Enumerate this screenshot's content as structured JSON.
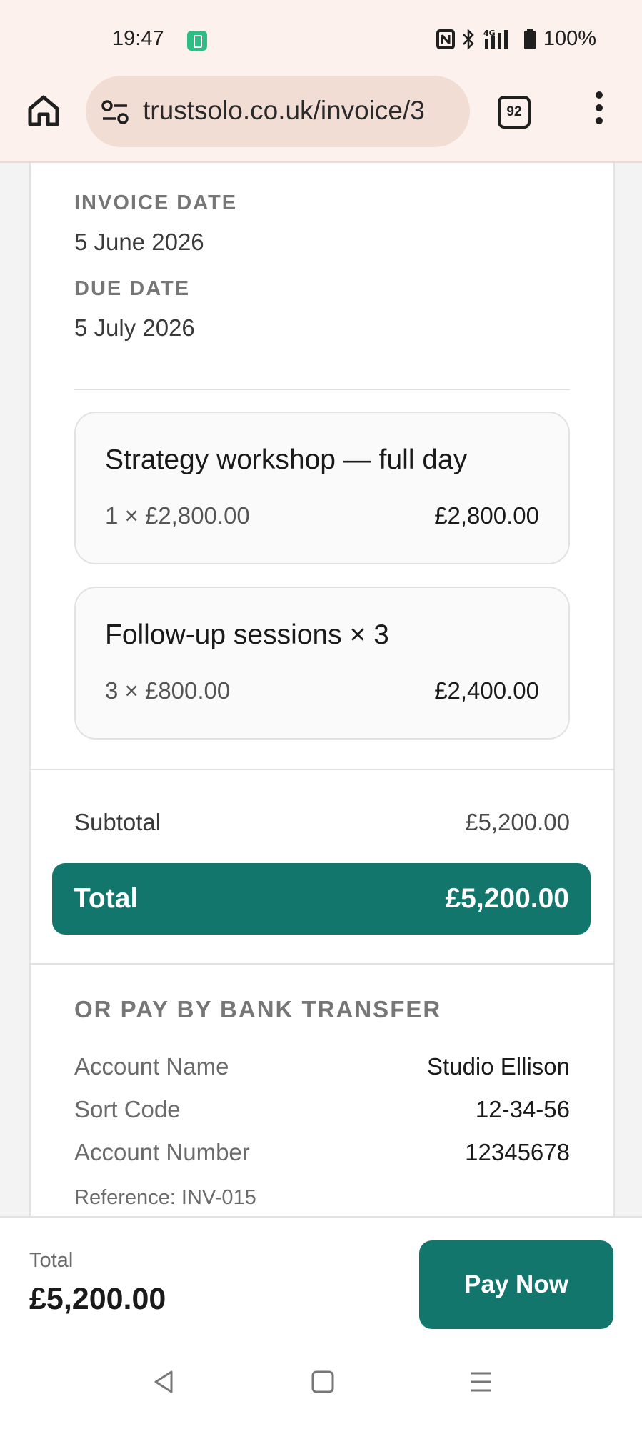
{
  "status_bar": {
    "time": "19:47",
    "battery": "100%",
    "icons": [
      "app-notification-icon",
      "nfc-icon",
      "bluetooth-icon",
      "signal-4g-icon",
      "battery-icon"
    ]
  },
  "browser": {
    "url": "trustsolo.co.uk/invoice/3",
    "tab_count": "92",
    "icons": [
      "home-icon",
      "site-settings-icon",
      "tab-switcher-icon",
      "more-menu-icon"
    ]
  },
  "invoice": {
    "invoice_date_label": "INVOICE DATE",
    "invoice_date": "5 June 2026",
    "due_date_label": "DUE DATE",
    "due_date": "5 July 2026",
    "items": [
      {
        "name": "Strategy workshop — full day",
        "qty": "1 × £2,800.00",
        "amount": "£2,800.00"
      },
      {
        "name": "Follow-up sessions × 3",
        "qty": "3 × £800.00",
        "amount": "£2,400.00"
      }
    ],
    "subtotal_label": "Subtotal",
    "subtotal": "£5,200.00",
    "total_label": "Total",
    "total": "£5,200.00"
  },
  "bank_transfer": {
    "title": "OR PAY BY BANK TRANSFER",
    "rows": [
      {
        "label": "Account Name",
        "value": "Studio Ellison"
      },
      {
        "label": "Sort Code",
        "value": "12-34-56"
      },
      {
        "label": "Account Number",
        "value": "12345678"
      }
    ],
    "reference": "Reference: INV-015"
  },
  "pay_bar": {
    "total_label": "Total",
    "total": "£5,200.00",
    "button_label": "Pay Now"
  },
  "colors": {
    "accent": "#12766c",
    "chrome_bg": "#fcf1ed",
    "url_bar_bg": "#f2ddd5"
  }
}
